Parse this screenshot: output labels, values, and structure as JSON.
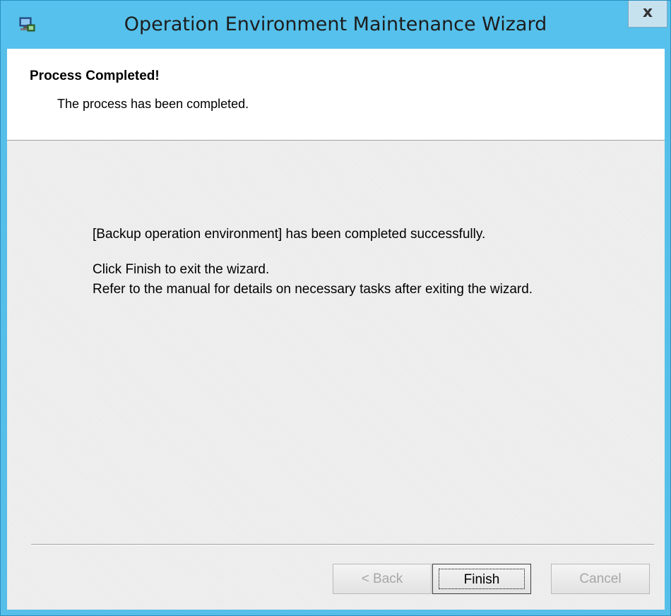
{
  "window": {
    "title": "Operation Environment Maintenance Wizard",
    "close_symbol": "x",
    "icon": "computer-network-icon"
  },
  "header": {
    "title": "Process Completed!",
    "subtitle": "The process has been completed."
  },
  "body": {
    "line1": "[Backup operation environment] has been completed successfully.",
    "line2": "Click Finish to exit the wizard.",
    "line3": "Refer to the manual for details on necessary tasks after exiting the wizard."
  },
  "buttons": {
    "back": "< Back",
    "finish": "Finish",
    "cancel": "Cancel",
    "back_enabled": false,
    "cancel_enabled": false
  },
  "colors": {
    "titlebar": "#56c1ec",
    "client": "#efefef",
    "disabled_text": "#a7a7a7"
  }
}
